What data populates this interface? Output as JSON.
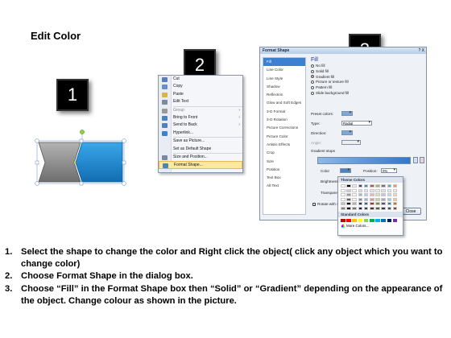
{
  "slide": {
    "title": "Edit Color",
    "steps": [
      "1",
      "2",
      "3"
    ]
  },
  "context_menu": {
    "items": [
      {
        "label": "Cut",
        "icon": "scissors-icon",
        "disabled": false
      },
      {
        "label": "Copy",
        "icon": "copy-icon",
        "disabled": false
      },
      {
        "label": "Paste",
        "icon": "paste-icon",
        "disabled": false
      },
      {
        "label": "Edit Text",
        "icon": "edit-text-icon",
        "disabled": false
      },
      {
        "label": "Group",
        "icon": "group-icon",
        "disabled": true,
        "submenu": true
      },
      {
        "label": "Bring to Front",
        "icon": "bring-front-icon",
        "disabled": false,
        "submenu": true
      },
      {
        "label": "Send to Back",
        "icon": "send-back-icon",
        "disabled": false,
        "submenu": true
      },
      {
        "label": "Hyperlink...",
        "icon": "hyperlink-icon",
        "disabled": false
      },
      {
        "label": "Save as Picture...",
        "icon": "",
        "disabled": false
      },
      {
        "label": "Set as Default Shape",
        "icon": "",
        "disabled": false
      },
      {
        "label": "Size and Position...",
        "icon": "size-icon",
        "disabled": false
      },
      {
        "label": "Format Shape...",
        "icon": "format-shape-icon",
        "disabled": false,
        "selected": true
      }
    ]
  },
  "dialog": {
    "title": "Format Shape",
    "window_buttons": "? X",
    "nav": [
      "Fill",
      "Line Color",
      "Line Style",
      "Shadow",
      "Reflection",
      "Glow and Soft Edges",
      "3-D Format",
      "3-D Rotation",
      "Picture Corrections",
      "Picture Color",
      "Artistic Effects",
      "Crop",
      "Size",
      "Position",
      "Text Box",
      "Alt Text"
    ],
    "active_nav": "Fill",
    "pane_heading": "Fill",
    "fill_options": [
      {
        "label": "No fill",
        "checked": false
      },
      {
        "label": "Solid fill",
        "checked": false
      },
      {
        "label": "Gradient fill",
        "checked": true
      },
      {
        "label": "Picture or texture fill",
        "checked": false
      },
      {
        "label": "Pattern fill",
        "checked": false
      },
      {
        "label": "Slide background fill",
        "checked": false
      }
    ],
    "preset_colors_label": "Preset colors:",
    "type_label": "Type:",
    "type_value": "Radial",
    "direction_label": "Direction:",
    "angle_label": "Angle:",
    "gradient_stops_label": "Gradient stops",
    "color_label": "Color",
    "position_label": "Position:",
    "position_value": "0%",
    "brightness_label": "Brightness:",
    "transparency_label": "Transparency:",
    "rotate_label": "Rotate with shape",
    "close_label": "Close"
  },
  "palette": {
    "theme_label": "Theme Colors",
    "standard_label": "Standard Colors",
    "more_label": "More Colors...",
    "theme_top": [
      "#ffffff",
      "#000000",
      "#eeece1",
      "#1f497d",
      "#4f81bd",
      "#c0504d",
      "#9bbb59",
      "#8064a2",
      "#4bacc6",
      "#f79646"
    ],
    "standard": [
      "#c00000",
      "#ff0000",
      "#ffc000",
      "#ffff00",
      "#92d050",
      "#00b050",
      "#00b0f0",
      "#0070c0",
      "#002060",
      "#7030a0"
    ]
  },
  "instructions": [
    {
      "num": "1.",
      "text": "Select the shape to change the color and Right click the object( click any object which you want to change color)"
    },
    {
      "num": "2.",
      "text": "Choose Format Shape in the dialog box."
    },
    {
      "num": "3.",
      "text": "Choose “Fill” in the Format Shape box then “Solid” or “Gradient” depending on the appearance of the object. Change colour as shown in the picture."
    }
  ],
  "colors": {
    "shape_left": "#8c8c8c",
    "shape_right": "#1e8ed6",
    "accent": "#3d7fd1"
  }
}
